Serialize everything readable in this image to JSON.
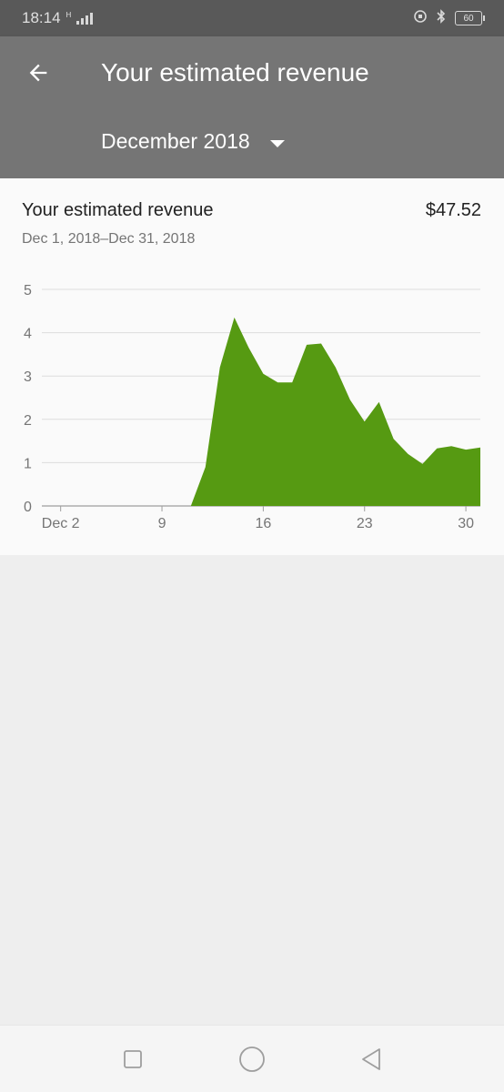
{
  "status_bar": {
    "time": "18:14",
    "network_type": "H",
    "battery_level": "60",
    "icons": [
      "signal-icon",
      "alarm-icon",
      "bluetooth-icon",
      "battery-icon"
    ]
  },
  "app_bar": {
    "title": "Your estimated revenue",
    "back_icon": "arrow-back-icon",
    "month_selected": "December 2018",
    "month_caret_icon": "dropdown-caret-icon"
  },
  "card": {
    "title": "Your estimated revenue",
    "amount": "$47.52",
    "date_range": "Dec 1, 2018–Dec 31, 2018"
  },
  "chart_data": {
    "type": "area",
    "title": "",
    "xlabel": "",
    "ylabel": "",
    "x_tick_labels": [
      "Dec 2",
      "9",
      "16",
      "23",
      "30"
    ],
    "x_tick_days": [
      2,
      9,
      16,
      23,
      30
    ],
    "y_ticks": [
      0,
      1,
      2,
      3,
      4,
      5
    ],
    "ylim": [
      0,
      5
    ],
    "xlim": [
      1,
      31
    ],
    "grid": true,
    "color": "#569a12",
    "series": [
      {
        "x": [
          1,
          2,
          3,
          4,
          5,
          6,
          7,
          8,
          9,
          10,
          11,
          12,
          13,
          14,
          15,
          16,
          17,
          18,
          19,
          20,
          21,
          22,
          23,
          24,
          25,
          26,
          27,
          28,
          29,
          30,
          31
        ],
        "values": [
          0,
          0,
          0,
          0,
          0,
          0,
          0,
          0,
          0,
          0,
          0,
          0.9,
          3.2,
          4.35,
          3.65,
          3.05,
          2.85,
          2.85,
          3.72,
          3.75,
          3.2,
          2.45,
          1.95,
          2.4,
          1.55,
          1.2,
          0.97,
          1.33,
          1.38,
          1.3,
          1.35
        ]
      }
    ]
  },
  "nav_bar": {
    "icons": [
      "recents-square-icon",
      "home-circle-icon",
      "back-triangle-icon"
    ]
  }
}
